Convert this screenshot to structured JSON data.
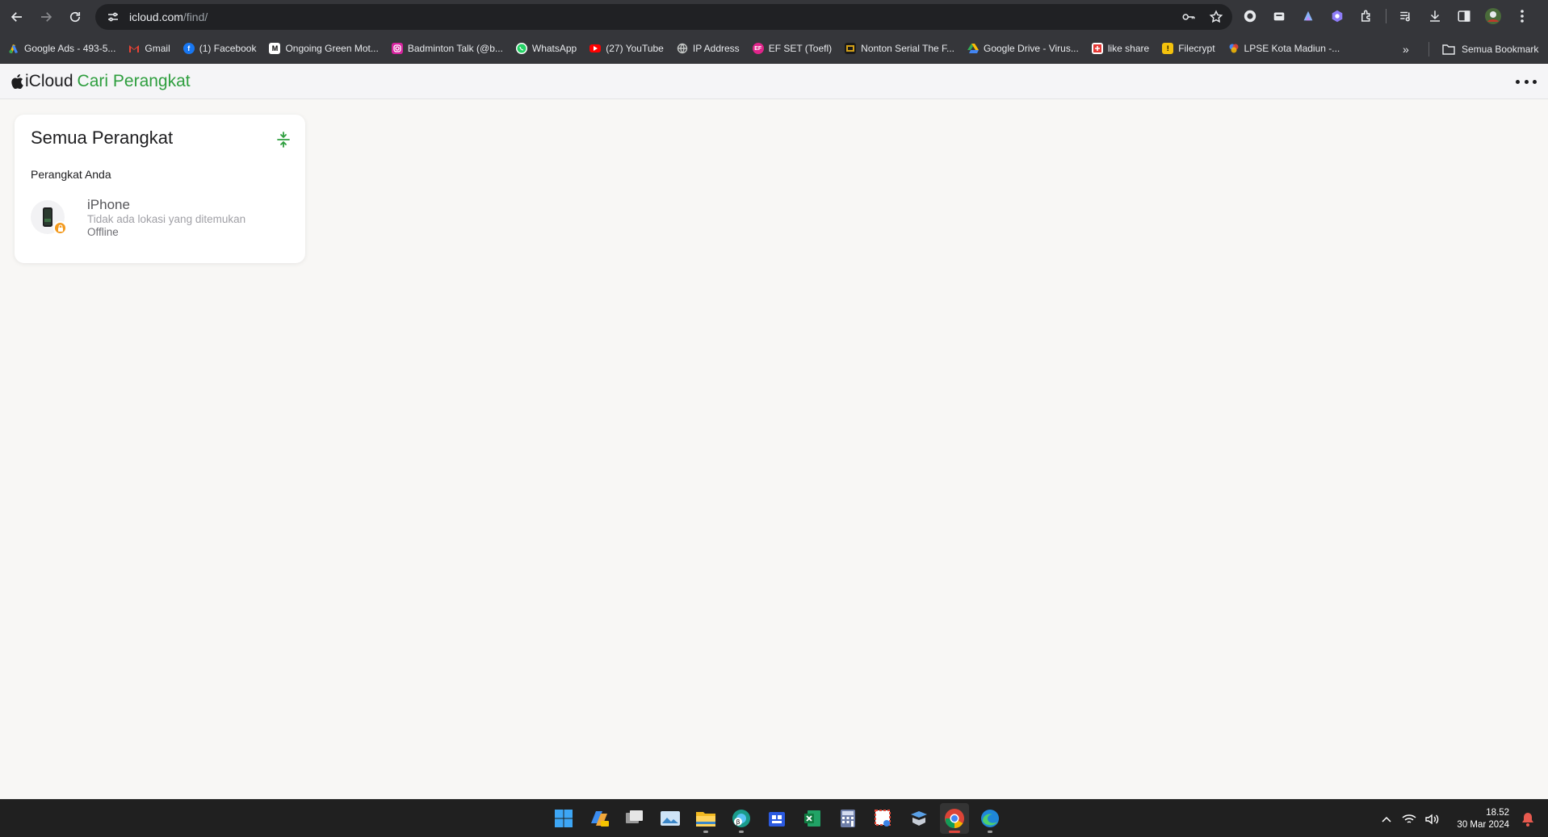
{
  "browser": {
    "url_host": "icloud.com",
    "url_path": "/find/",
    "icons": [
      "back-arrow-icon",
      "forward-arrow-icon",
      "reload-icon",
      "site-settings-icon",
      "password-key-icon",
      "bookmark-star-icon"
    ]
  },
  "bookmarks": {
    "items": [
      {
        "label": "Google Ads - 493-5...",
        "icon": "google-ads-icon",
        "color": "#4285f4"
      },
      {
        "label": "Gmail",
        "icon": "gmail-icon",
        "color": "#ea4335"
      },
      {
        "label": "(1) Facebook",
        "icon": "facebook-icon",
        "color": "#1877f2"
      },
      {
        "label": "Ongoing Green Mot...",
        "icon": "m-logo-icon",
        "color": "#ffffff"
      },
      {
        "label": "Badminton Talk (@b...",
        "icon": "instagram-icon",
        "color": "#d6249f"
      },
      {
        "label": "WhatsApp",
        "icon": "whatsapp-icon",
        "color": "#25d366"
      },
      {
        "label": "(27) YouTube",
        "icon": "youtube-icon",
        "color": "#ff0000"
      },
      {
        "label": "IP Address",
        "icon": "globe-icon",
        "color": "#9aa0a6"
      },
      {
        "label": "EF SET (Toefl)",
        "icon": "ef-icon",
        "color": "#e0248a"
      },
      {
        "label": "Nonton Serial The F...",
        "icon": "film-icon",
        "color": "#d4a017"
      },
      {
        "label": "Google Drive - Virus...",
        "icon": "google-drive-icon",
        "color": "#34a853"
      },
      {
        "label": "like share",
        "icon": "like-share-icon",
        "color": "#e53935"
      },
      {
        "label": "Filecrypt",
        "icon": "filecrypt-icon",
        "color": "#f4c20d"
      },
      {
        "label": "LPSE Kota Madiun -...",
        "icon": "lpse-icon",
        "color": "#4285f4"
      }
    ],
    "overflow": "»",
    "all_bookmarks": "Semua Bookmark"
  },
  "app": {
    "brand": "iCloud",
    "product": "Cari Perangkat",
    "accent_color": "#2e9e3e"
  },
  "panel": {
    "title": "Semua Perangkat",
    "section": "Perangkat Anda",
    "devices": [
      {
        "name": "iPhone",
        "location": "Tidak ada lokasi yang ditemukan",
        "status": "Offline",
        "badge_color": "#f39a1e"
      }
    ]
  },
  "taskbar": {
    "apps": [
      "windows-start-icon",
      "copilot-icon",
      "task-view-icon",
      "photos-icon",
      "file-explorer-icon",
      "edge-beta-icon",
      "store-icon",
      "excel-icon",
      "calculator-icon",
      "snipping-tool-icon",
      "vpn-icon",
      "chrome-icon",
      "edge-icon"
    ],
    "time": "18.52",
    "date": "30 Mar 2024"
  }
}
